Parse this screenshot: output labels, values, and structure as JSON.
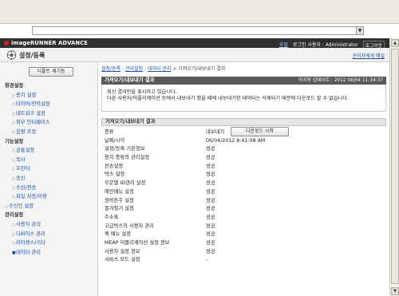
{
  "app": {
    "brand": "imageRUNNER ADVANCE",
    "portal_link": "포털",
    "login_user_label": "로그인 사용자 : Administrator",
    "logout_label": "로그아웃",
    "page_title": "설정/등록",
    "portal_manage_link": "관리자에게 메일"
  },
  "sidebar": {
    "reset_label": "디폴트 재기동",
    "items": [
      {
        "type": "group",
        "label": "환경설정"
      },
      {
        "type": "item",
        "label": "용지 설정"
      },
      {
        "type": "item",
        "label": "타이머/전력설정"
      },
      {
        "type": "item",
        "label": "네트워크 설정"
      },
      {
        "type": "item",
        "label": "외부 인터페이스"
      },
      {
        "type": "item",
        "label": "음량 조정"
      },
      {
        "type": "group",
        "label": "기능설정"
      },
      {
        "type": "item",
        "label": "공통설정"
      },
      {
        "type": "item",
        "label": "복사"
      },
      {
        "type": "item",
        "label": "프린터"
      },
      {
        "type": "item",
        "label": "송신"
      },
      {
        "type": "item",
        "label": "수신/전송"
      },
      {
        "type": "item",
        "label": "파일 저장/이용"
      },
      {
        "type": "toplevel",
        "label": "수신인 설정"
      },
      {
        "type": "group",
        "label": "관리설정"
      },
      {
        "type": "item",
        "label": "사용자 관리"
      },
      {
        "type": "item",
        "label": "디바이스 관리"
      },
      {
        "type": "item",
        "label": "라이센스/기타"
      },
      {
        "type": "active",
        "label": "데이터 관리"
      }
    ]
  },
  "main": {
    "breadcrumb": {
      "part1": "설정/등록",
      "sep1": " : ",
      "part2": "관리설정",
      "sep2": " : ",
      "part3": "데이터 관리",
      "sep3": " > ",
      "part4": "가져오기/내보내기 결과"
    },
    "section_title": "가져오기/내보내기 결과",
    "last_updated": "마지막 업데이트 : 2012 06/04 11:34:37",
    "message_line1": "최신 결과만을 표시하고 있습니다.",
    "message_line2": "다른 사용자/어플리케이션 등에서 내보내기 했을 때에 내보내기한 데이터는 삭제되기 때문에 다운로드 할 수 없습니다.",
    "result_heading": "가져오기/내보내기 결과",
    "download_label": "다운로드 시작",
    "rows": [
      {
        "label": "종류",
        "value": "내보내기"
      },
      {
        "label": "날짜/시각",
        "value": "06/04/2012 8:41:08 AM"
      },
      {
        "label": "설정/등록 기본정보",
        "value": "성공"
      },
      {
        "label": "용지 종류의 관리설정",
        "value": "성공"
      },
      {
        "label": "전송설정",
        "value": "성공"
      },
      {
        "label": "박스 설정",
        "value": "성공"
      },
      {
        "label": "부문별 ID관리 설정",
        "value": "성공"
      },
      {
        "label": "메인메뉴 설정",
        "value": "성공"
      },
      {
        "label": "원버튼주 설정",
        "value": "성공"
      },
      {
        "label": "즐겨찾기 설정",
        "value": "성공"
      },
      {
        "label": "주소록",
        "value": "성공"
      },
      {
        "label": "고급박스의 사용자 관리",
        "value": "성공"
      },
      {
        "label": "퀵 메뉴 설정",
        "value": "성공"
      },
      {
        "label": "MEAP 어플리케이션 설정 정보",
        "value": "성공"
      },
      {
        "label": "사용자 설정 정보",
        "value": "성공"
      },
      {
        "label": "서비스 모드 설정",
        "value": "-"
      }
    ]
  }
}
